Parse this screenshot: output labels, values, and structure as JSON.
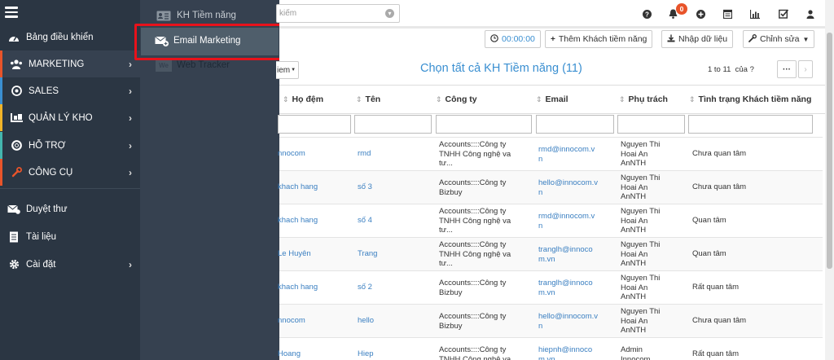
{
  "colors": {
    "sidebar_bg": "#2b3643",
    "flyout_bg": "#364150",
    "accent_link": "#3a8fd1",
    "highlight_box": "#e8121b"
  },
  "sidebar": {
    "menu_icon": "hamburger-icon",
    "items": [
      {
        "label": "Bảng điều khiển",
        "icon": "dashboard-icon"
      },
      {
        "label": "MARKETING",
        "icon": "users-icon",
        "chevron": "›"
      },
      {
        "label": "SALES",
        "icon": "target-icon",
        "chevron": "›"
      },
      {
        "label": "QUẢN LÝ KHO",
        "icon": "warehouse-icon",
        "chevron": "›"
      },
      {
        "label": "HỖ TRỢ",
        "icon": "lifebuoy-icon",
        "chevron": "›"
      },
      {
        "label": "CÔNG CỤ",
        "icon": "wrench-icon",
        "chevron": "›"
      },
      {
        "label": "Duyệt thư",
        "icon": "mail-check-icon"
      },
      {
        "label": "Tài liệu",
        "icon": "document-icon"
      },
      {
        "label": "Cài đặt",
        "icon": "gear-icon",
        "chevron": "›"
      }
    ],
    "item_colors": [
      "",
      "#e8542a",
      "#3a8fd1",
      "#f0b429",
      "#44b6ae",
      "#e8542a"
    ]
  },
  "flyout": {
    "items": [
      {
        "label": "KH Tiềm năng",
        "icon": "contact-card-icon"
      },
      {
        "label": "Email Marketing",
        "icon": "email-marketing-icon"
      },
      {
        "label": "Web Tracker",
        "icon": "web-tracker-icon",
        "icon_text": "We"
      }
    ]
  },
  "topbar": {
    "search_placeholder": "kiếm",
    "notification_count": "0",
    "icons": [
      "help-icon",
      "bell-icon",
      "add-circle-icon",
      "calendar-icon",
      "chart-icon",
      "tasks-icon",
      "user-icon"
    ]
  },
  "toolbar": {
    "timer": "00:00:00",
    "add_label": "Thêm Khách tiềm năng",
    "import_label": "Nhập dữ liệu",
    "edit_label": "Chỉnh sửa"
  },
  "list": {
    "filter_label": "iem",
    "title": "Chọn tất cả KH Tiềm năng (11)",
    "pager_text": "1 to 11",
    "pager_of": "của ?",
    "more": "···"
  },
  "table": {
    "columns": [
      "Họ đệm",
      "Tên",
      "Công ty",
      "Email",
      "Phụ trách",
      "Tình trạng Khách tiềm năng"
    ],
    "rows": [
      {
        "ho": "nnocom",
        "ten": "rmd",
        "cty": [
          "Accounts::::Công ty",
          "TNHH Công nghệ va",
          "tư..."
        ],
        "email": [
          "rmd@innocom.v",
          "n"
        ],
        "pt": [
          "Nguyen Thi",
          "Hoai An",
          "AnNTH"
        ],
        "tt": "Chưa quan tâm"
      },
      {
        "ho": "khach hang",
        "ten": "số 3",
        "cty": [
          "Accounts::::Công ty",
          "Bizbuy"
        ],
        "email": [
          "hello@innocom.v",
          "n"
        ],
        "pt": [
          "Nguyen Thi",
          "Hoai An",
          "AnNTH"
        ],
        "tt": "Chưa quan tâm"
      },
      {
        "ho": "khach hang",
        "ten": "số 4",
        "cty": [
          "Accounts::::Công ty",
          "TNHH Công nghệ va",
          "tư..."
        ],
        "email": [
          "rmd@innocom.v",
          "n"
        ],
        "pt": [
          "Nguyen Thi",
          "Hoai An",
          "AnNTH"
        ],
        "tt": "Quan tâm"
      },
      {
        "ho": "Le Huyên",
        "ten": "Trang",
        "cty": [
          "Accounts::::Công ty",
          "TNHH Công nghệ va",
          "tư..."
        ],
        "email": [
          "tranglh@innoco",
          "m.vn"
        ],
        "pt": [
          "Nguyen Thi",
          "Hoai An",
          "AnNTH"
        ],
        "tt": "Quan tâm"
      },
      {
        "ho": "khach hang",
        "ten": "số 2",
        "cty": [
          "Accounts::::Công ty",
          "Bizbuy"
        ],
        "email": [
          "tranglh@innoco",
          "m.vn"
        ],
        "pt": [
          "Nguyen Thi",
          "Hoai An",
          "AnNTH"
        ],
        "tt": "Rất quan tâm"
      },
      {
        "ho": "nnocom",
        "ten": "hello",
        "cty": [
          "Accounts::::Công ty",
          "Bizbuy"
        ],
        "email": [
          "hello@innocom.v",
          "n"
        ],
        "pt": [
          "Nguyen Thi",
          "Hoai An",
          "AnNTH"
        ],
        "tt": "Chưa quan tâm"
      },
      {
        "ho": "Hoang",
        "ten": "Hiep",
        "cty": [
          "Accounts::::Công ty",
          "TNHH Công nghệ va"
        ],
        "email": [
          "hiepnh@innoco",
          "m.vn"
        ],
        "pt": [
          "Admin",
          "Innocom"
        ],
        "tt": "Rất quan tâm"
      }
    ]
  }
}
